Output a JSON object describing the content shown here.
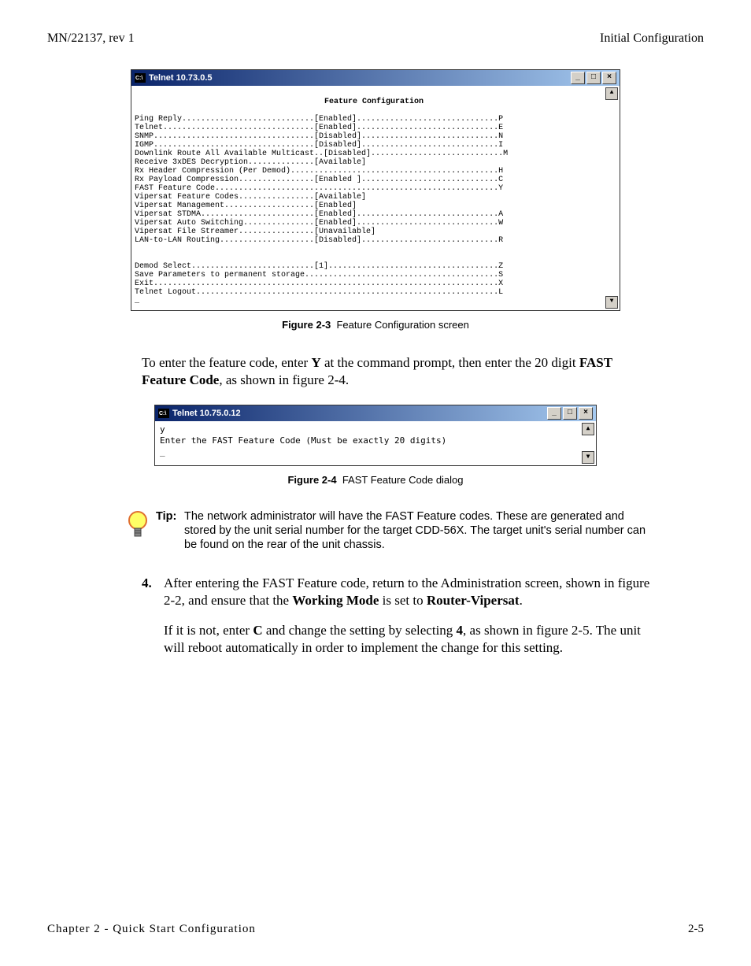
{
  "header": {
    "left": "MN/22137, rev 1",
    "right": "Initial Configuration"
  },
  "fig23": {
    "title": "Telnet 10.73.0.5",
    "heading": "Feature Configuration",
    "lines": [
      "Ping Reply............................[Enabled]..............................P",
      "Telnet................................[Enabled]..............................E",
      "SNMP..................................[Disabled].............................N",
      "IGMP..................................[Disabled].............................I",
      "Downlink Route All Available Multicast..[Disabled]............................M",
      "Receive 3xDES Decryption..............[Available]",
      "Rx Header Compression (Per Demod)............................................H",
      "Rx Payload Compression................[Enabled ].............................C",
      "FAST Feature Code............................................................Y",
      "Vipersat Feature Codes................[Available]",
      "Vipersat Management...................[Enabled]",
      "Vipersat STDMA........................[Enabled]..............................A",
      "Vipersat Auto Switching...............[Enabled]..............................W",
      "Vipersat File Streamer................[Unavailable]",
      "LAN-to-LAN Routing....................[Disabled].............................R",
      "",
      "",
      "Demod Select..........................[1]....................................Z",
      "Save Parameters to permanent storage.........................................S",
      "Exit.........................................................................X",
      "Telnet Logout................................................................L",
      "_"
    ],
    "caption_bold": "Figure 2-3",
    "caption_rest": "Feature Configuration screen"
  },
  "para1_a": "To enter the feature code, enter ",
  "para1_b": "Y",
  "para1_c": " at the command prompt, then enter the 20 digit ",
  "para1_d": "FAST Feature Code",
  "para1_e": ", as shown in figure 2-4.",
  "fig24": {
    "title": "Telnet 10.75.0.12",
    "line1": "y",
    "line2": "Enter the FAST Feature Code (Must be exactly 20 digits)",
    "line3": "_",
    "caption_bold": "Figure 2-4",
    "caption_rest": "FAST Feature Code dialog"
  },
  "tip": {
    "label": "Tip:",
    "text": "The network administrator will have the FAST Feature codes. These are generated and stored by the unit serial number for the target CDD-56X. The target unit's serial number can be found on the rear of the unit chassis."
  },
  "step4": {
    "num": "4.",
    "p1_a": "After entering the FAST Feature code, return to the Administration screen, shown in figure 2-2, and ensure that the ",
    "p1_b": "Working Mode",
    "p1_c": " is set to ",
    "p1_d": "Router-Vipersat",
    "p1_e": ".",
    "p2_a": "If it is not, enter ",
    "p2_b": "C",
    "p2_c": " and change the setting by selecting ",
    "p2_d": "4",
    "p2_e": ", as shown in figure 2-5. The unit will reboot automatically in order to implement the change for this setting."
  },
  "footer": {
    "left": "Chapter 2 - Quick Start Configuration",
    "right": "2-5"
  }
}
